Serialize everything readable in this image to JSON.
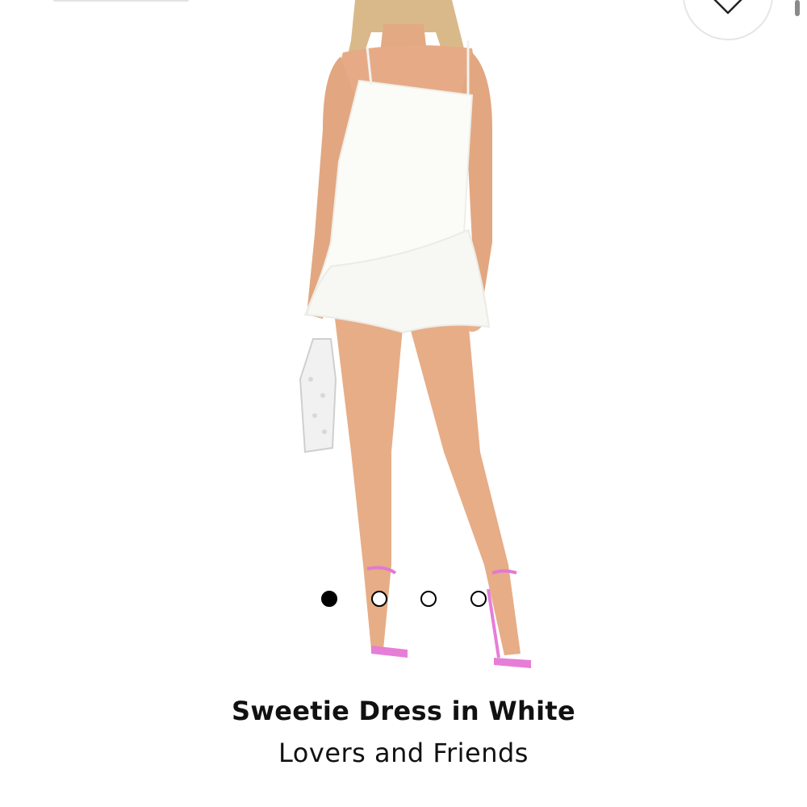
{
  "product": {
    "title": "Sweetie Dress in White",
    "brand": "Lovers and Friends"
  },
  "carousel": {
    "total_slides": 4,
    "active_index": 0
  },
  "icons": {
    "wishlist": "heart-outline-icon"
  },
  "colors": {
    "text": "#111111",
    "dot_active": "#000000",
    "background": "#ffffff"
  }
}
